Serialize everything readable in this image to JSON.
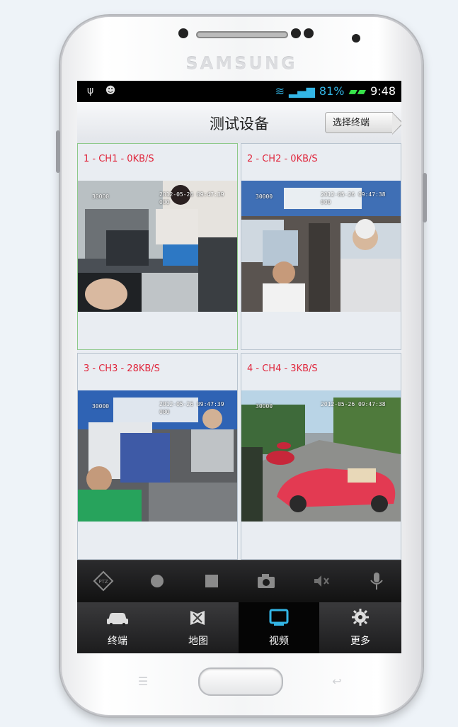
{
  "device": {
    "brand": "SAMSUNG"
  },
  "status_bar": {
    "battery": "81%",
    "time": "9:48"
  },
  "header": {
    "title": "测试设备",
    "select_button": "选择终端"
  },
  "channels": [
    {
      "label": "1 - CH1 - 0KB/S",
      "osd_id": "30000",
      "osd_time": "2012-05-26 09:47:39",
      "osd_sub": "000"
    },
    {
      "label": "2 - CH2 - 0KB/S",
      "osd_id": "30000",
      "osd_time": "2012-05-26 09:47:38",
      "osd_sub": "000"
    },
    {
      "label": "3 - CH3 - 28KB/S",
      "osd_id": "30000",
      "osd_time": "2012-05-26 09:47:39",
      "osd_sub": "000"
    },
    {
      "label": "4 - CH4 - 3KB/S",
      "osd_id": "30000",
      "osd_time": "2012-05-26 09:47:38",
      "osd_sub": ""
    }
  ],
  "controls": [
    "ptz-icon",
    "record-icon",
    "stop-icon",
    "camera-icon",
    "mute-icon",
    "microphone-icon"
  ],
  "tabs": [
    {
      "label": "终端",
      "icon": "car-icon"
    },
    {
      "label": "地图",
      "icon": "map-icon"
    },
    {
      "label": "视频",
      "icon": "monitor-icon",
      "active": true
    },
    {
      "label": "更多",
      "icon": "gear-icon"
    }
  ],
  "colors": {
    "channel_label": "#e0263c",
    "status_blue": "#33b5e5",
    "active_tab": "#33b5e5"
  }
}
